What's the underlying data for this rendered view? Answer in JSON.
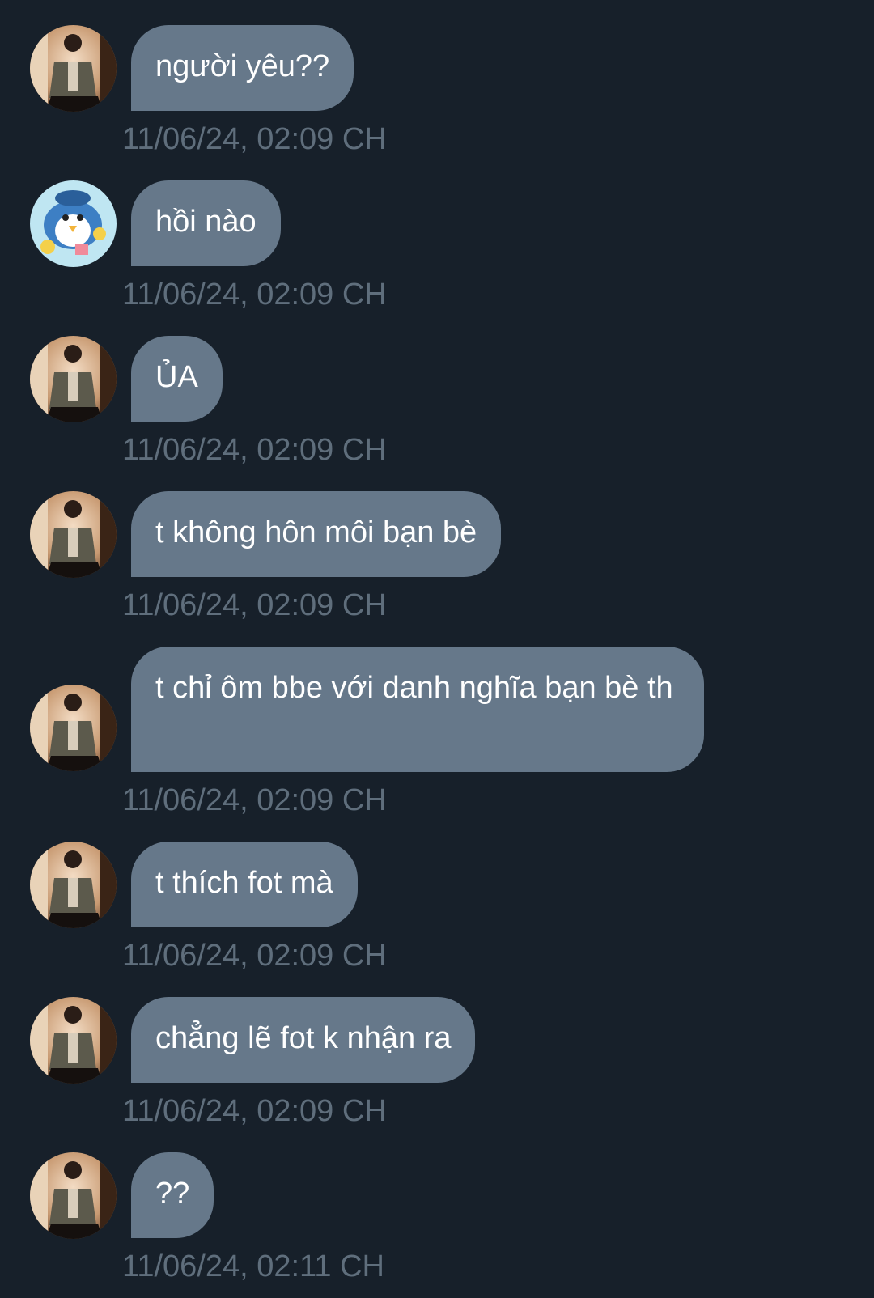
{
  "conversation": {
    "messages": [
      {
        "sender": "user-a",
        "text": "người yêu??",
        "timestamp": "11/06/24, 02:09 CH"
      },
      {
        "sender": "user-b",
        "text": "hồi nào",
        "timestamp": "11/06/24, 02:09 CH"
      },
      {
        "sender": "user-a",
        "text": "ỦA",
        "timestamp": "11/06/24, 02:09 CH"
      },
      {
        "sender": "user-a",
        "text": "t không hôn môi bạn bè",
        "timestamp": "11/06/24, 02:09 CH"
      },
      {
        "sender": "user-a",
        "text": "t chỉ ôm bbe với danh nghĩa bạn bè th",
        "timestamp": "11/06/24, 02:09 CH"
      },
      {
        "sender": "user-a",
        "text": "t thích fot mà",
        "timestamp": "11/06/24, 02:09 CH"
      },
      {
        "sender": "user-a",
        "text": "chẳng lẽ fot k nhận ra",
        "timestamp": "11/06/24, 02:09 CH"
      },
      {
        "sender": "user-a",
        "text": "??",
        "timestamp": "11/06/24, 02:11 CH"
      }
    ]
  },
  "colors": {
    "background": "#17202a",
    "bubble": "#66788a",
    "bubble_text": "#ffffff",
    "timestamp_text": "#5f6e7c"
  },
  "icons": {
    "user-a": "person-photo-avatar",
    "user-b": "cartoon-penguin-avatar"
  }
}
